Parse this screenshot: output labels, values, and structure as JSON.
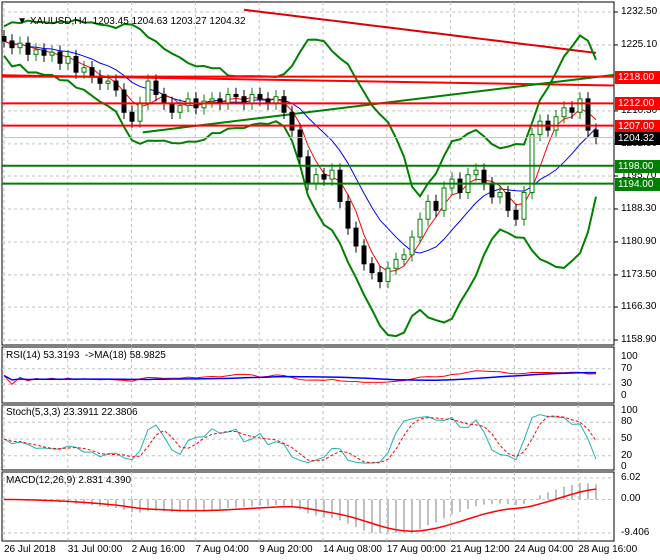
{
  "header": {
    "symbol": "XAUUSD,H4",
    "ohlc": "1203.45 1204.63 1203.27 1204.32"
  },
  "colors": {
    "bull": "#008000",
    "bear": "#000000",
    "band": "#008000",
    "level_red": "#ff0000",
    "level_green": "#008000",
    "rsi": "#ff0000",
    "rsi_ma": "#0000ff",
    "stoch_main": "#20b2aa",
    "stoch_signal": "#ff0000",
    "macd_hist": "#c0c0c0",
    "macd_signal": "#ff0000"
  },
  "price_axis": {
    "ticks": [
      "1232.50",
      "1225.10",
      "1210.30",
      "1202.90",
      "1195.70",
      "1188.30",
      "1180.90",
      "1173.50",
      "1166.30",
      "1158.90"
    ],
    "range": [
      1158.9,
      1232.5
    ]
  },
  "levels": [
    {
      "price": 1218.0,
      "label": "1218.00",
      "color": "#ff0000"
    },
    {
      "price": 1212.0,
      "label": "1212.00",
      "color": "#ff0000"
    },
    {
      "price": 1207.0,
      "label": "1207.00",
      "color": "#ff0000"
    },
    {
      "price": 1198.0,
      "label": "1198.00",
      "color": "#008000"
    },
    {
      "price": 1194.0,
      "label": "1194.00",
      "color": "#008000"
    }
  ],
  "current_price": {
    "price": 1204.32,
    "label": "1204.32"
  },
  "trendlines": [
    {
      "from": [
        0,
        1218.3
      ],
      "to": [
        1,
        1216.0
      ],
      "color": "#ff0000"
    },
    {
      "from": [
        0.23,
        1205.5
      ],
      "to": [
        1,
        1218.4
      ],
      "color": "#008000"
    }
  ],
  "chart_data": {
    "type": "candlestick",
    "closes": [
      1226,
      1224.5,
      1225.5,
      1223,
      1224,
      1222.8,
      1223.5,
      1221,
      1222.5,
      1219,
      1220,
      1218,
      1216.5,
      1217,
      1215,
      1210,
      1208,
      1212,
      1217,
      1214,
      1212,
      1210,
      1211.5,
      1213,
      1211,
      1212.5,
      1213,
      1212,
      1214,
      1213.5,
      1212,
      1214,
      1213,
      1212,
      1213.5,
      1210,
      1206,
      1200,
      1194,
      1196,
      1195,
      1197,
      1190,
      1184,
      1180,
      1176,
      1174,
      1172,
      1175,
      1177,
      1178,
      1182,
      1186,
      1190,
      1188,
      1193,
      1195,
      1192,
      1196,
      1197,
      1194,
      1191,
      1192,
      1188,
      1186,
      1192,
      1205,
      1208,
      1206,
      1209,
      1211,
      1210,
      1213,
      1206,
      1204.32
    ],
    "x_ticks": [
      "26 Jul 2018",
      "31 Jul 00:00",
      "2 Aug 16:00",
      "7 Aug 04:00",
      "9 Aug 20:00",
      "14 Aug 08:00",
      "17 Aug 00:00",
      "21 Aug 12:00",
      "24 Aug 04:00",
      "28 Aug 16:00"
    ]
  },
  "rsi": {
    "label": "RSI(14) 53.3193  ->MA(18) 58.9825",
    "ticks": [
      "100",
      "70",
      "30",
      "0"
    ]
  },
  "stoch": {
    "label": "Stoch(5,3,3) 23.3911 22.3806",
    "ticks": [
      "100",
      "80",
      "50",
      "20",
      "0"
    ]
  },
  "macd": {
    "label": "MACD(12,26,9) 2.831 4.390",
    "ticks": [
      "6.02",
      "0.00",
      "-9.406"
    ]
  }
}
